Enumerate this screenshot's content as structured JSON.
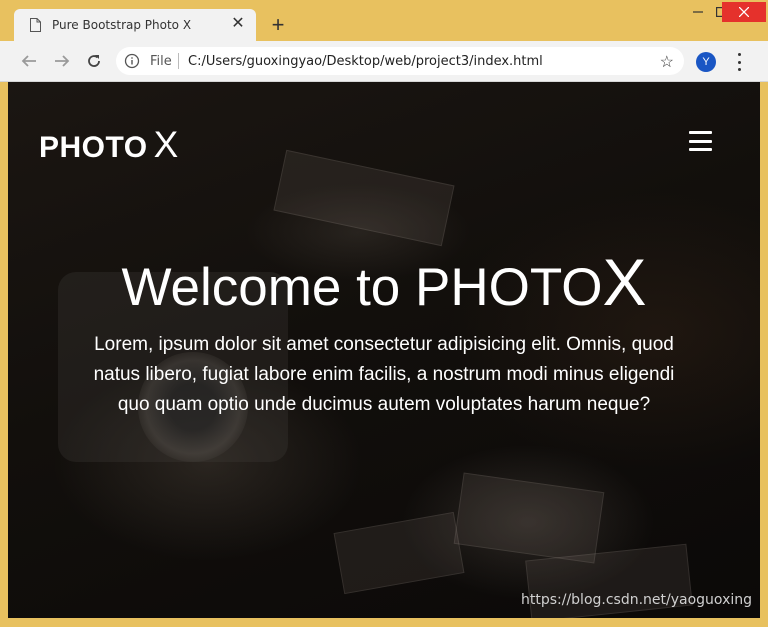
{
  "browser": {
    "tab_title": "Pure Bootstrap Photo X",
    "tab_close": "✕",
    "new_tab": "+",
    "omnibox": {
      "scheme": "File",
      "url": "C:/Users/guoxingyao/Desktop/web/project3/index.html",
      "star": "☆"
    },
    "profile_initial": "Y",
    "colors": {
      "frame": "#e8c15f",
      "close": "#e5312c",
      "profile": "#1a56c4"
    }
  },
  "page": {
    "brand": {
      "word": "PHOTO",
      "x": "X"
    },
    "hero": {
      "title_main": "Welcome to PHOTO",
      "title_x": "X",
      "text": "Lorem, ipsum dolor sit amet consectetur adipisicing elit. Omnis, quod natus libero, fugiat labore enim facilis, a nostrum modi minus eligendi quo quam optio unde ducimus autem voluptates harum neque?"
    },
    "watermark": "https://blog.csdn.net/yaoguoxing"
  }
}
